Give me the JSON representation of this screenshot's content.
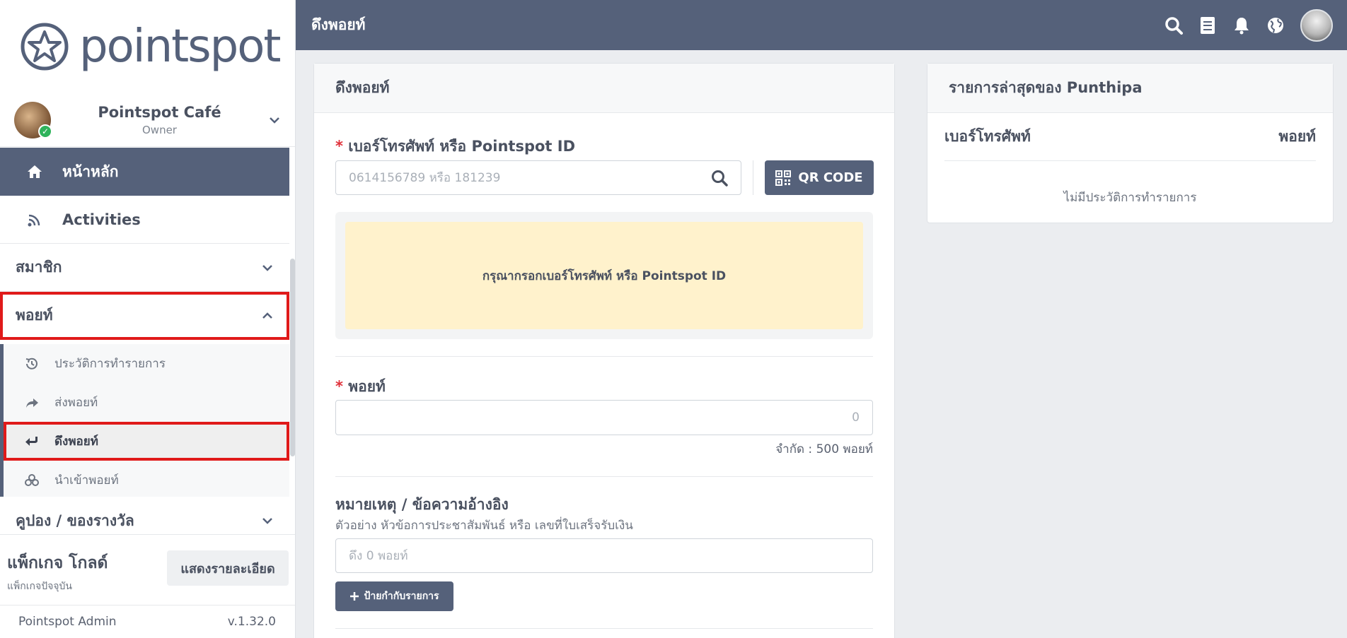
{
  "brand": {
    "name": "pointspot"
  },
  "shop": {
    "name": "Pointspot Café",
    "role": "Owner"
  },
  "nav": {
    "home": "หน้าหลัก",
    "activities": "Activities",
    "members": "สมาชิก",
    "points": "พอยท์",
    "points_sub": [
      "ประวัติการทำรายการ",
      "ส่งพอยท์",
      "ดึงพอยท์",
      "นำเข้าพอยท์"
    ],
    "coupons": "คูปอง / ของรางวัล"
  },
  "package": {
    "title": "แพ็กเกจ โกลด์",
    "subtitle": "แพ็กเกจปัจจุบัน",
    "button": "แสดงรายละเอียด"
  },
  "footer": {
    "app": "Pointspot Admin",
    "version": "v.1.32.0"
  },
  "topbar": {
    "title": "ดึงพอยท์"
  },
  "form": {
    "card_title": "ดึงพอยท์",
    "phone_label": "เบอร์โทรศัพท์ หรือ Pointspot ID",
    "phone_placeholder": "0614156789 หรือ 181239",
    "qr_label": "QR CODE",
    "notice": "กรุณากรอกเบอร์โทรศัพท์ หรือ Pointspot ID",
    "point_label": "พอยท์",
    "point_placeholder": "0",
    "limit": "จำกัด : 500 พอยท์",
    "note_label": "หมายเหตุ / ข้อความอ้างอิง",
    "note_hint": "ตัวอย่าง หัวข้อการประชาสัมพันธ์ หรือ เลขที่ใบเสร็จรับเงิน",
    "note_placeholder": "ดึง 0 พอยท์",
    "tag_button": "ป้ายกำกับรายการ"
  },
  "recent": {
    "title": "รายการล่าสุดของ Punthipa",
    "col_phone": "เบอร์โทรศัพท์",
    "col_point": "พอยท์",
    "empty": "ไม่มีประวัติการทำรายการ"
  },
  "colors": {
    "primary": "#55617a",
    "highlight": "#e01a1a",
    "notice_bg": "#fff2cc",
    "required": "#e0313a"
  }
}
